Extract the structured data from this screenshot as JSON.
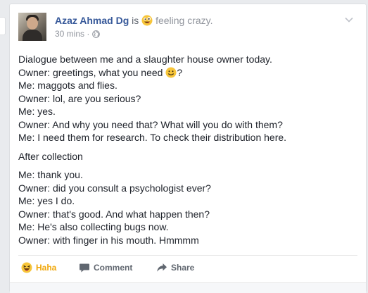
{
  "post": {
    "author": "Azaz Ahmad Dg",
    "is_word": "is",
    "feeling": "feeling crazy.",
    "time": "30 mins",
    "dot": "·",
    "emoji_feeling": "crazy-face-emoji",
    "privacy_icon": "globe-icon",
    "menu_icon": "chevron-down-icon"
  },
  "content": {
    "paragraphs": [
      {
        "lines": [
          "Dialogue between me and a slaughter house owner today.",
          "Owner: greetings, what you need",
          "Me: maggots and flies.",
          "Owner: lol, are you serious?",
          "Me: yes.",
          "Owner: And why you need that? What will you do with them?",
          "Me: I need them for research. To check their distribution here."
        ],
        "line2_suffix": "?"
      },
      {
        "lines": [
          "After collection"
        ]
      },
      {
        "lines": [
          "Me: thank you.",
          "Owner: did you consult a psychologist ever?",
          "Me: yes I do.",
          "Owner: that's good. And what happen then?",
          "Me: He's also collecting bugs now.",
          "Owner: with finger in his mouth. Hmmmm"
        ]
      }
    ]
  },
  "actions": {
    "haha": "Haha",
    "comment": "Comment",
    "share": "Share"
  },
  "colors": {
    "link": "#365899",
    "haha": "#f0a70a",
    "muted": "#90949c",
    "background": "#e9ebee"
  }
}
